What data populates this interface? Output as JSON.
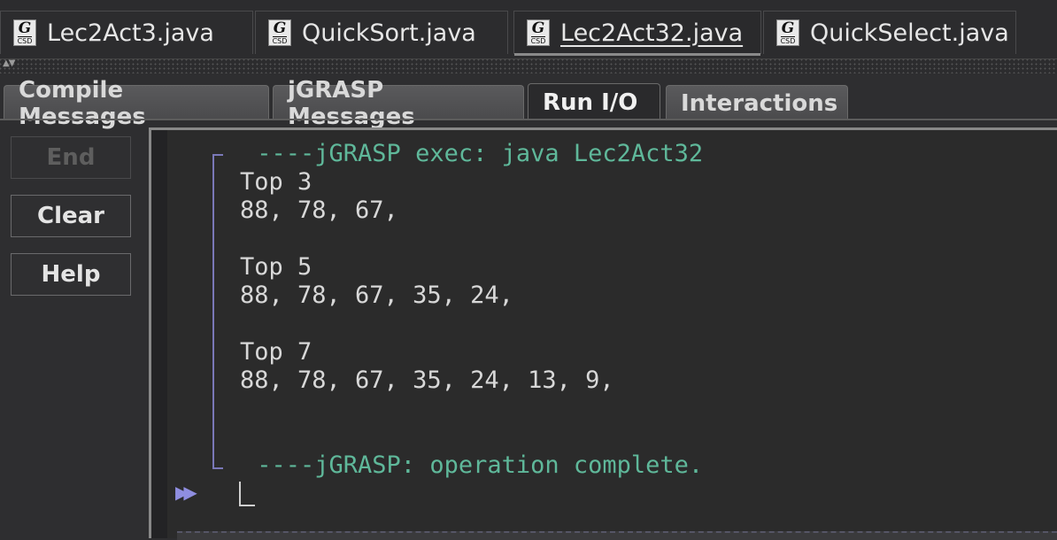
{
  "file_tabs": [
    {
      "label": "Lec2Act3.java",
      "icon": "csd-file-icon",
      "active": false
    },
    {
      "label": "QuickSort.java",
      "icon": "csd-file-icon",
      "active": false
    },
    {
      "label": "Lec2Act32.java",
      "icon": "csd-file-icon",
      "active": true
    },
    {
      "label": "QuickSelect.java",
      "icon": "csd-file-icon",
      "active": false
    }
  ],
  "csd_icon": {
    "glyph": "G",
    "text": "CSD"
  },
  "message_tabs": [
    {
      "label": "Compile Messages",
      "active": false
    },
    {
      "label": "jGRASP Messages",
      "active": false
    },
    {
      "label": "Run I/O",
      "active": true
    },
    {
      "label": "Interactions",
      "active": false
    }
  ],
  "side_buttons": {
    "end": "End",
    "clear": "Clear",
    "help": "Help"
  },
  "console": {
    "exec_line": " ----jGRASP exec: java Lec2Act32",
    "output": [
      "Top 3",
      "88, 78, 67,",
      "",
      "Top 5",
      "88, 78, 67, 35, 24,",
      "",
      "Top 7",
      "88, 78, 67, 35, 24, 13, 9,"
    ],
    "complete_line": " ----jGRASP: operation complete.",
    "prompt_glyph": "▶▶"
  },
  "colors": {
    "exec_text": "#5fb89a",
    "bracket": "#7a78b8",
    "prompt": "#8f8ee0"
  }
}
